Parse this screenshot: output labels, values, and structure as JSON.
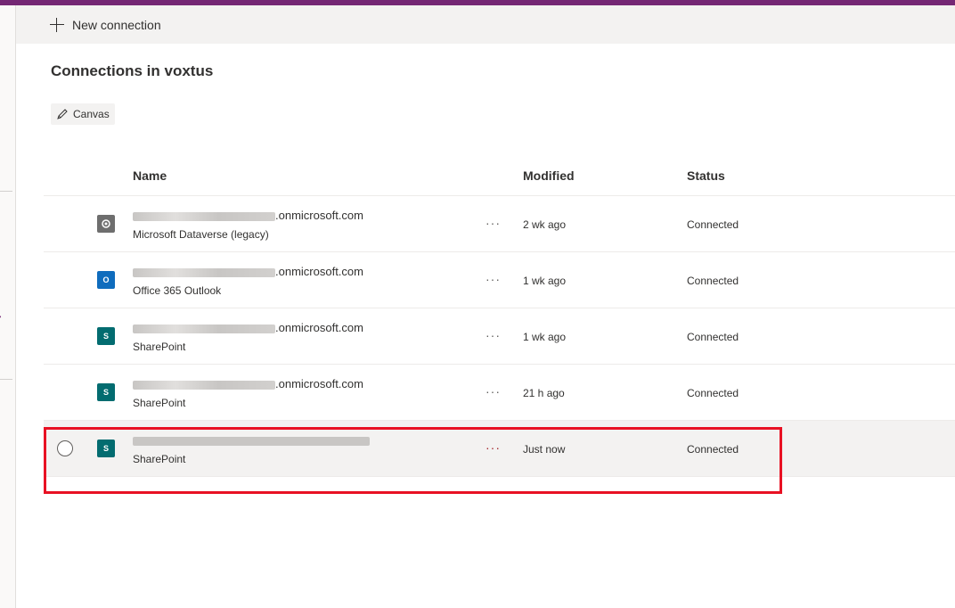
{
  "toolbar": {
    "new_connection_label": "New connection"
  },
  "page": {
    "title": "Connections in voxtus"
  },
  "filter": {
    "label": "Canvas"
  },
  "table": {
    "headers": {
      "name": "Name",
      "modified": "Modified",
      "status": "Status"
    },
    "rows": [
      {
        "name_suffix": ".onmicrosoft.com",
        "connector": "Microsoft Dataverse (legacy)",
        "modified": "2 wk ago",
        "status": "Connected",
        "icon": "dataverse-icon",
        "icon_color": "#6e6e6e",
        "more": "···"
      },
      {
        "name_suffix": ".onmicrosoft.com",
        "connector": "Office 365 Outlook",
        "modified": "1 wk ago",
        "status": "Connected",
        "icon": "outlook-icon",
        "icon_color": "#0f6cbd",
        "more": "···"
      },
      {
        "name_suffix": ".onmicrosoft.com",
        "connector": "SharePoint",
        "modified": "1 wk ago",
        "status": "Connected",
        "icon": "sharepoint-icon",
        "icon_color": "#036c70",
        "more": "···"
      },
      {
        "name_suffix": ".onmicrosoft.com",
        "connector": "SharePoint",
        "modified": "21 h ago",
        "status": "Connected",
        "icon": "sharepoint-icon",
        "icon_color": "#036c70",
        "more": "···"
      },
      {
        "name_suffix": "",
        "connector": "SharePoint",
        "modified": "Just now",
        "status": "Connected",
        "icon": "sharepoint-icon",
        "icon_color": "#036c70",
        "more": "···"
      }
    ]
  },
  "colors": {
    "brand": "#742774",
    "highlight": "#e81123"
  }
}
